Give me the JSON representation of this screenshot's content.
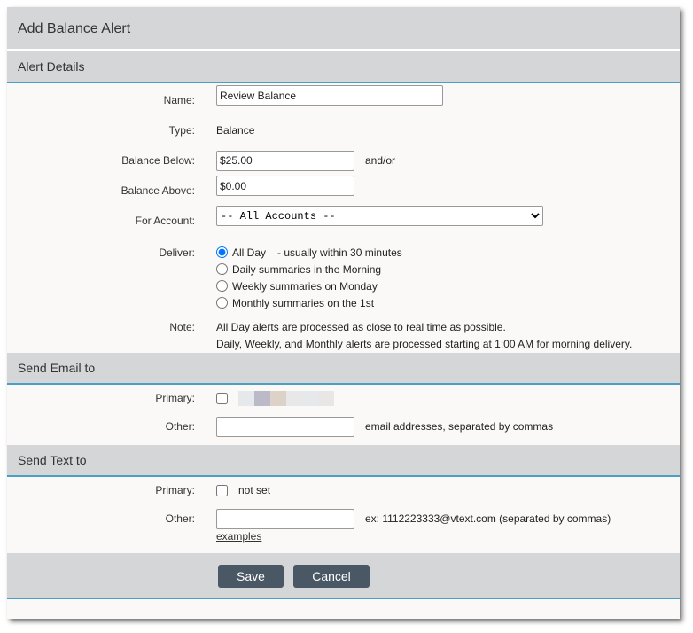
{
  "title": "Add Balance Alert",
  "alert_details": {
    "header": "Alert Details",
    "name_label": "Name:",
    "name_value": "Review Balance",
    "type_label": "Type:",
    "type_value": "Balance",
    "below_label": "Balance Below:",
    "below_value": "$25.00",
    "andor": "and/or",
    "above_label": "Balance Above:",
    "above_value": "$0.00",
    "account_label": "For Account:",
    "account_value": "-- All Accounts --",
    "deliver_label": "Deliver:",
    "deliver_options": [
      "All Day",
      "Daily summaries in the Morning",
      "Weekly summaries on Monday",
      "Monthly summaries on the 1st"
    ],
    "all_day_note": "- usually within 30 minutes",
    "selected_option": "All Day",
    "note_label": "Note:",
    "note_lines": [
      "All Day alerts are processed as close to real time as possible.",
      "Daily, Weekly, and Monthly alerts are processed starting at 1:00 AM for morning delivery."
    ]
  },
  "email": {
    "header": "Send Email to",
    "primary_label": "Primary:",
    "other_label": "Other:",
    "other_value": "",
    "other_hint": "email addresses, separated by commas"
  },
  "text": {
    "header": "Send Text to",
    "primary_label": "Primary:",
    "primary_value": "not set",
    "other_label": "Other:",
    "other_value": "",
    "other_hint": "ex: 1112223333@vtext.com (separated by commas)",
    "examples_link": "examples"
  },
  "buttons": {
    "save": "Save",
    "cancel": "Cancel"
  }
}
